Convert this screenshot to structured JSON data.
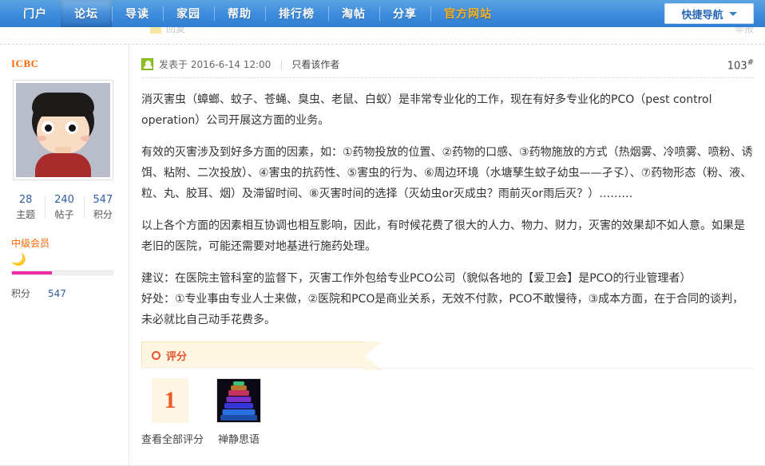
{
  "topnav": {
    "items": [
      {
        "label": "门户",
        "active": false,
        "highlight": false
      },
      {
        "label": "论坛",
        "active": true,
        "highlight": false
      },
      {
        "label": "导读",
        "active": false,
        "highlight": false
      },
      {
        "label": "家园",
        "active": false,
        "highlight": false
      },
      {
        "label": "帮助",
        "active": false,
        "highlight": false
      },
      {
        "label": "排行榜",
        "active": false,
        "highlight": false
      },
      {
        "label": "淘帖",
        "active": false,
        "highlight": false
      },
      {
        "label": "分享",
        "active": false,
        "highlight": false
      },
      {
        "label": "官方网站",
        "active": false,
        "highlight": true
      }
    ],
    "quicknav_label": "快捷导航",
    "quicknav_icon": "chevron-down-icon",
    "accent_blue": "#2f7fd4",
    "highlight_orange": "#ffb31e"
  },
  "cutoff_row": {
    "left_label": "回复",
    "right_label": "举报"
  },
  "sidebar": {
    "username": "ICBC",
    "avatar_alt": "user-avatar",
    "stats": [
      {
        "value": "28",
        "label": "主题"
      },
      {
        "value": "240",
        "label": "帖子"
      },
      {
        "value": "547",
        "label": "积分"
      }
    ],
    "rank": "中级会员",
    "rank_icon": "crescent-moon-icon",
    "rank_color": "#ff6600",
    "progress_percent": 40,
    "progress_color": "#ef2ea6",
    "points_label": "积分",
    "points_value": "547"
  },
  "post": {
    "icon": "author-badge-icon",
    "posted_at": "发表于 2016-6-14 12:00",
    "separator": "|",
    "only_author": "只看该作者",
    "post_number": "103",
    "post_number_suffix": "#",
    "paragraphs": [
      "消灭害虫（蟑螂、蚊子、苍蝇、臭虫、老鼠、白蚁）是非常专业化的工作，现在有好多专业化的PCO（pest control operation）公司开展这方面的业务。",
      "有效的灭害涉及到好多方面的因素，如：①药物投放的位置、②药物的口感、③药物施放的方式（热烟雾、冷喷雾、喷粉、诱饵、粘附、二次投放）、④害虫的抗药性、⑤害虫的行为、⑥周边环境（水塘孳生蚊子幼虫——孑孓）、⑦药物形态（粉、液、粒、丸、胶耳、烟）及滞留时间、⑧灭害时间的选择（灭幼虫or灭成虫？雨前灭or雨后灭？）………",
      "以上各个方面的因素相互协调也相互影响，因此，有时候花费了很大的人力、物力、财力，灭害的效果却不如人意。如果是老旧的医院，可能还需要对地基进行施药处理。",
      "建议：在医院主管科室的监督下，灭害工作外包给专业PCO公司（貌似各地的【爱卫会】是PCO的行业管理者）",
      "好处：①专业事由专业人士来做，②医院和PCO是商业关系，无效不付款，PCO不敢慢待，③成本方面，在于合同的谈判，未必就比自己动手花费多。"
    ]
  },
  "rating": {
    "section_icon": "circle-outline-icon",
    "section_title": "评分",
    "score": "1",
    "score_caption": "查看全部评分",
    "rater_avatar_alt": "rater-avatar",
    "rater_name": "禅静思语",
    "accent_color": "#e8552d"
  }
}
